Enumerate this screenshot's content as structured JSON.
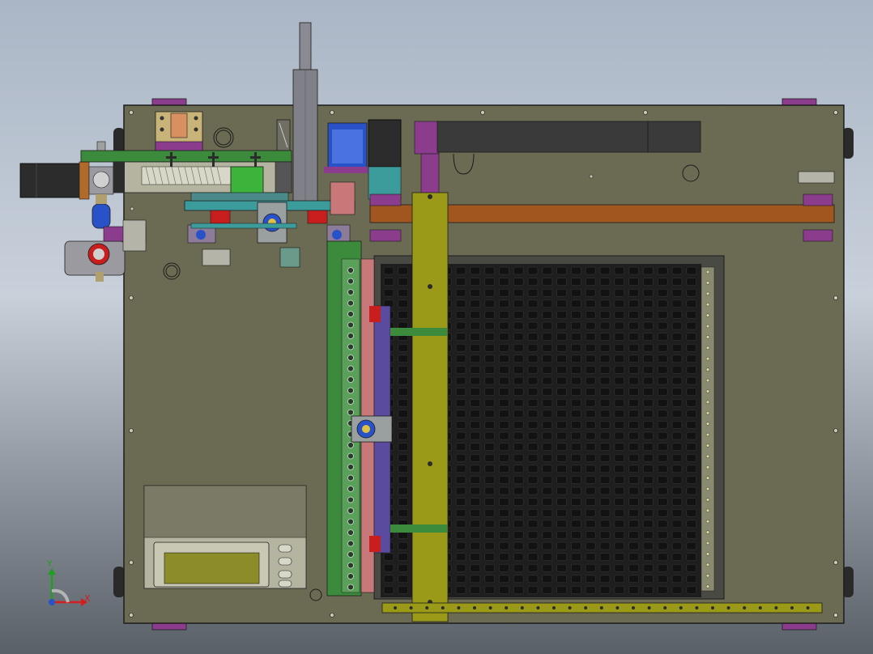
{
  "viewport": {
    "background_top": "#aab6c6",
    "background_bottom": "#5a6068"
  },
  "colors": {
    "base_plate": "#6b6a52",
    "frame_edge": "#1c1c1c",
    "motor_dark": "#2c2c2c",
    "rail_green": "#3c8a3c",
    "purple": "#8c3c8c",
    "teal": "#3c9c9c",
    "orange_beam": "#a0561e",
    "olive_beam": "#9a9a18",
    "blue_part": "#2a52c8",
    "red_part": "#c81e1e",
    "tray": "#1e1e1e",
    "pink": "#c87878"
  },
  "axis_triad": {
    "x_label": "X",
    "y_label": "Y",
    "x_color": "#d21e1e",
    "y_color": "#1ea01e"
  }
}
